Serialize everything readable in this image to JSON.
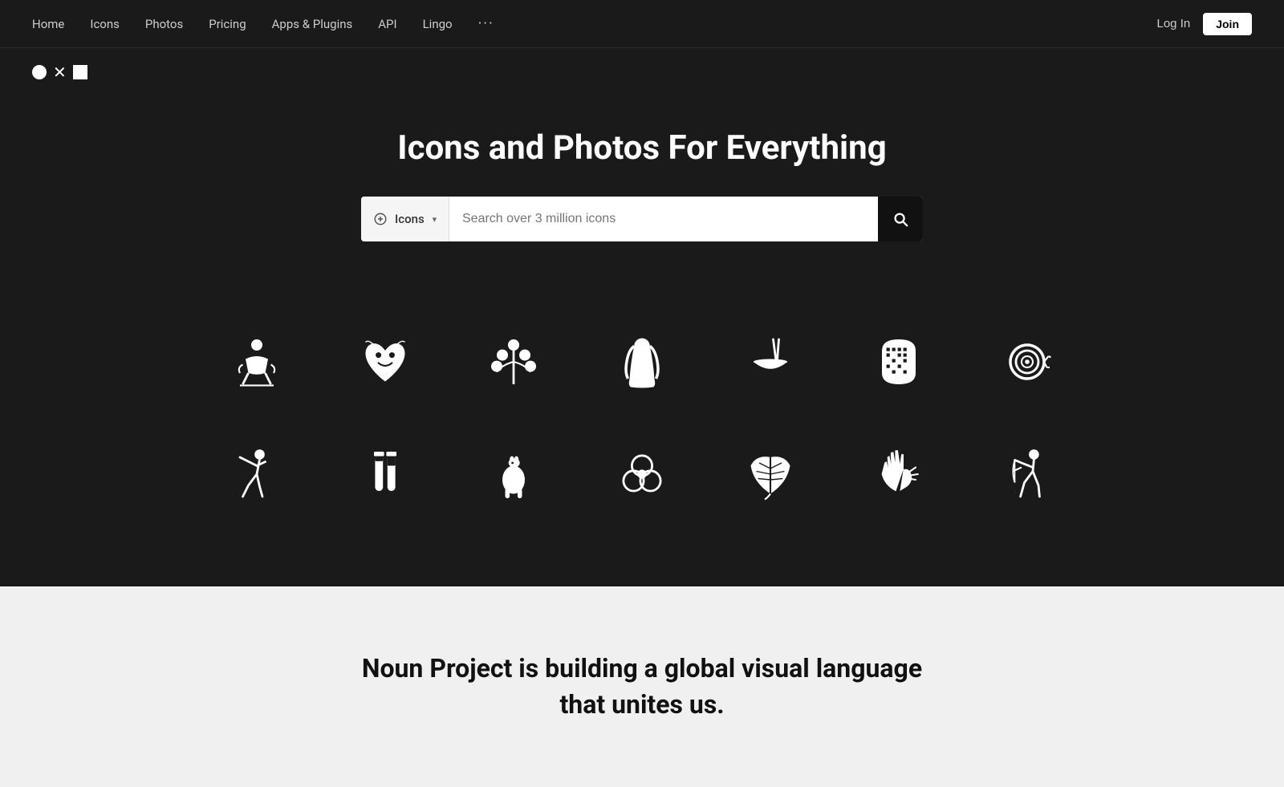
{
  "navbar": {
    "links": [
      {
        "label": "Home",
        "name": "home"
      },
      {
        "label": "Icons",
        "name": "icons"
      },
      {
        "label": "Photos",
        "name": "photos"
      },
      {
        "label": "Pricing",
        "name": "pricing"
      },
      {
        "label": "Apps & Plugins",
        "name": "apps-plugins"
      },
      {
        "label": "API",
        "name": "api"
      },
      {
        "label": "Lingo",
        "name": "lingo"
      }
    ],
    "more_label": "···",
    "login_label": "Log In",
    "join_label": "Join"
  },
  "hero": {
    "title": "Icons and Photos For Everything"
  },
  "search": {
    "type_label": "Icons",
    "placeholder": "Search over 3 million icons",
    "button_aria": "Search"
  },
  "bottom": {
    "title": "Noun Project is building a global visual language\nthat unites us."
  }
}
